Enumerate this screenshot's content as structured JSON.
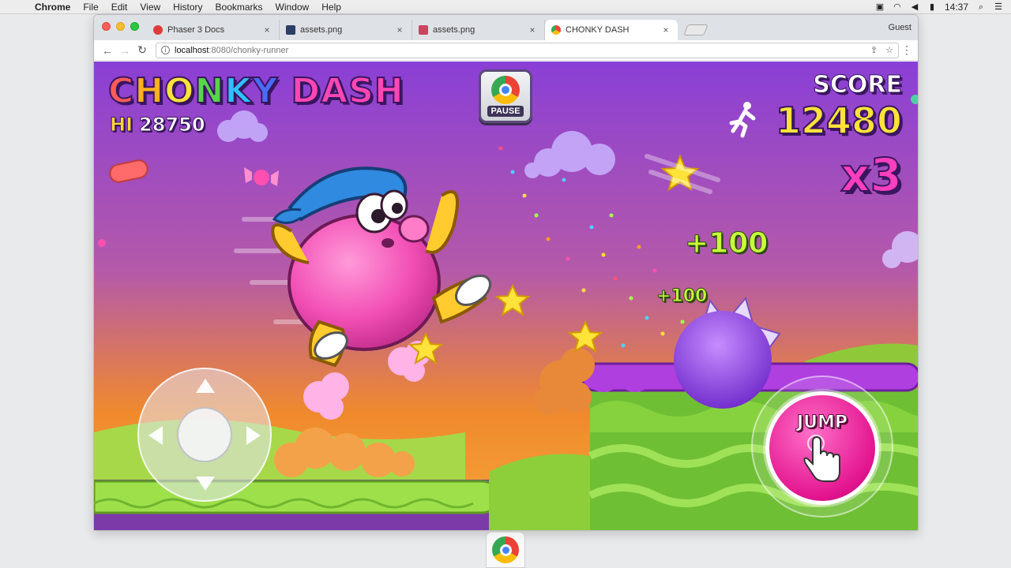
{
  "menubar": {
    "app": "Chrome",
    "items": [
      "File",
      "Edit",
      "View",
      "History",
      "Bookmarks",
      "Window",
      "Help"
    ],
    "clock": "14:37"
  },
  "browser": {
    "tabs": [
      {
        "label": "Phaser 3 Docs",
        "favicon_color": "#e03b3b"
      },
      {
        "label": "assets.png",
        "favicon_color": "#2c3e66"
      },
      {
        "label": "assets.png",
        "favicon_color": "#c9455e"
      },
      {
        "label": "CHONKY DASH",
        "favicon_color": "#4285f4"
      }
    ],
    "close_glyph": "×",
    "profile": "Guest",
    "url_host": "localhost",
    "url_path": ":8080/chonky-runner"
  },
  "game": {
    "title": {
      "c1": "C",
      "c2": "H",
      "c3": "O",
      "c4": "N",
      "c5": "K",
      "c6": "Y",
      "c7": " DASH"
    },
    "hi_label": "HI",
    "hi_score": "28750",
    "pause_label": "PAUSE",
    "score_label": "SCORE",
    "score_value": "12480",
    "multiplier": "x3",
    "bonus_1": "+100",
    "bonus_2": "+100",
    "jump_label": "JUMP"
  },
  "icons": {
    "pause": "chrome-logo-icon",
    "runner": "running-man-icon",
    "jump": "tap-hand-icon",
    "dock": "chrome-logo-icon"
  },
  "colors": {
    "sky_top": "#8a3fd6",
    "sky_bottom": "#f08a2c",
    "grass": "#8ad33a",
    "jump_button": "#e3148f",
    "score": "#ffe23a",
    "multiplier": "#ff3fc0"
  }
}
